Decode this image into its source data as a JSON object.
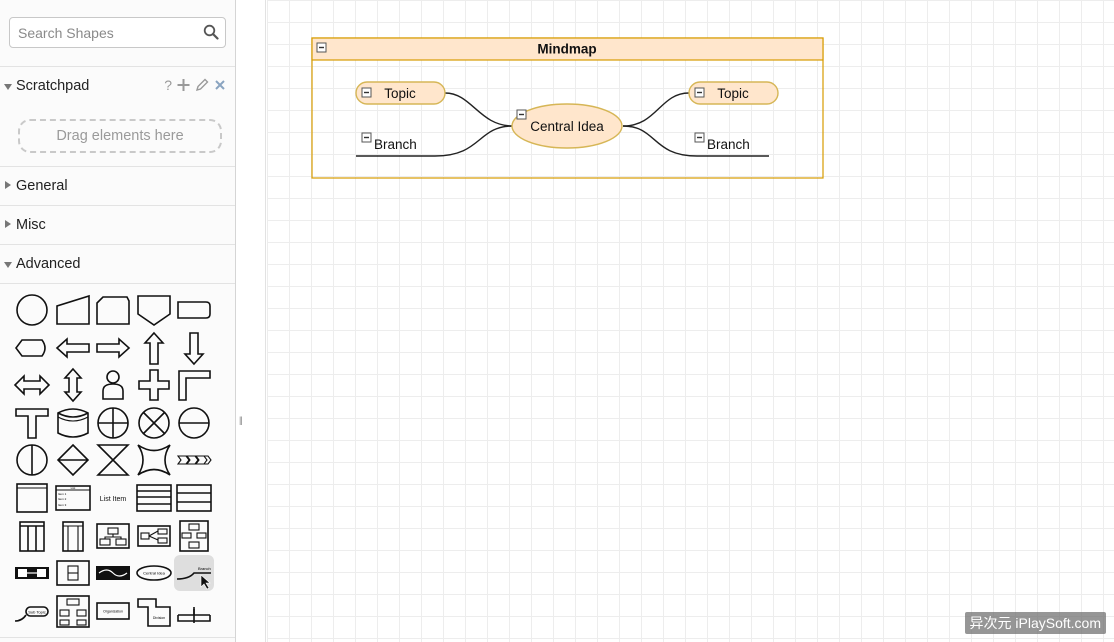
{
  "sidebar": {
    "search": {
      "placeholder": "Search Shapes",
      "value": ""
    },
    "scratchpad": {
      "label": "Scratchpad",
      "help_label": "?",
      "dropzone_text": "Drag elements here"
    },
    "sections": [
      {
        "label": "General",
        "expanded": false
      },
      {
        "label": "Misc",
        "expanded": false
      },
      {
        "label": "Advanced",
        "expanded": true
      }
    ],
    "advanced_shapes": [
      "ellipse",
      "manual-input",
      "card",
      "off-page-connector",
      "rounded-rectangle",
      "display",
      "left-arrow",
      "right-arrow",
      "up-arrow",
      "down-arrow",
      "left-right-arrow",
      "up-down-arrow",
      "actor",
      "cross",
      "corner",
      "tee",
      "data-storage",
      "or",
      "sum-function",
      "direct-access",
      "sort",
      "collate",
      "collate-hourglass",
      "star",
      "step",
      "container",
      "list",
      "list-item",
      "table",
      "table-rows",
      "vertical-pool",
      "vertical-lane",
      "org-chart",
      "horizontal-tree",
      "vertical-tree",
      "tree-container",
      "layout-container",
      "horizontal-flow",
      "central-idea",
      "branch",
      "sub-topic",
      "organization-chart",
      "organization",
      "division",
      "tree-connector"
    ],
    "selected_shape": "branch",
    "shape_text": {
      "list_item": "List Item",
      "central_idea": "Central Idea",
      "branch": "Branch",
      "sub_topic": "Sub Topic",
      "organization": "Organization",
      "division": "Division",
      "list": "List",
      "item1": "Item 1",
      "item2": "Item 2",
      "item3": "Item 3"
    }
  },
  "canvas": {
    "mindmap": {
      "title": "Mindmap",
      "central": "Central Idea",
      "topic_left": "Topic",
      "topic_right": "Topic",
      "branch_left": "Branch",
      "branch_right": "Branch"
    }
  },
  "colors": {
    "mindmap_fill": "#ffe6cc",
    "mindmap_stroke": "#d6b656",
    "container_stroke": "#d79b00",
    "grid": "#ededed"
  },
  "divider_handle": "||",
  "watermark": "异次元 iPlaySoft.com"
}
